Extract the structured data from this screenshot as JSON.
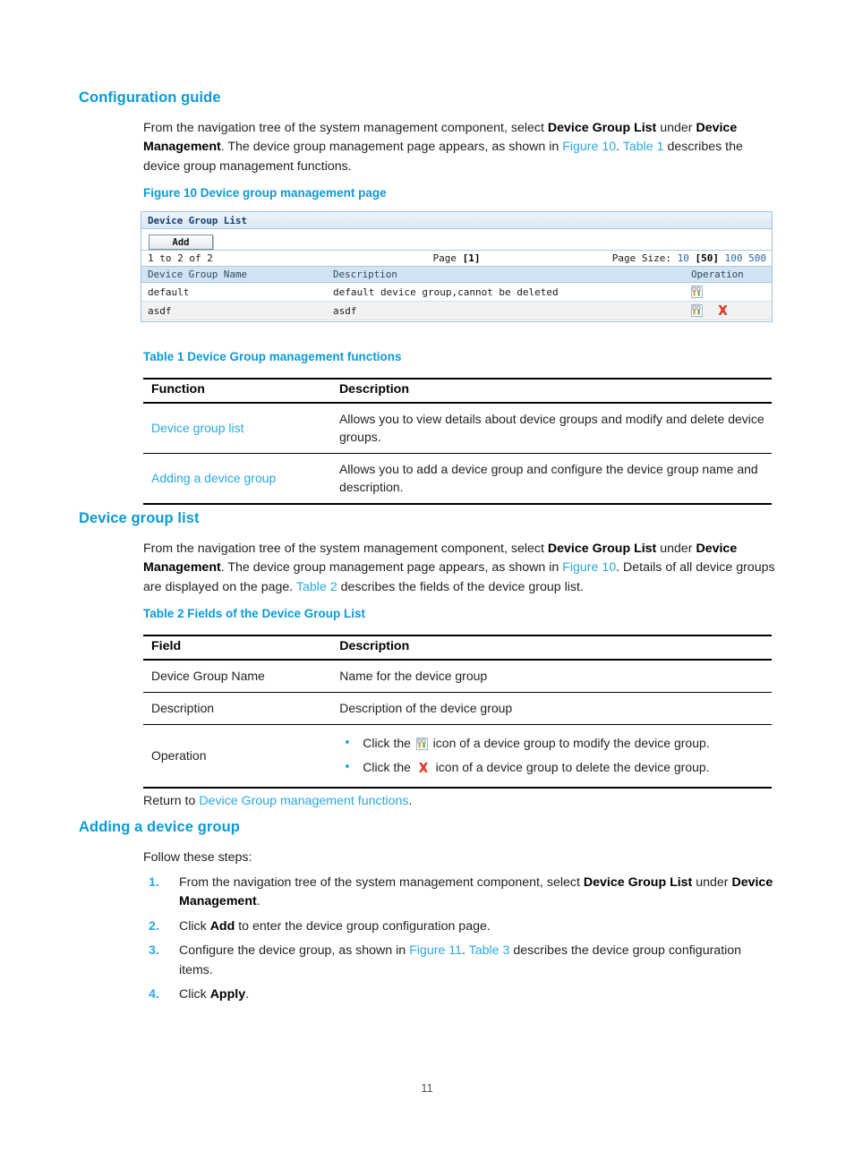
{
  "sections": {
    "configuration_guide": {
      "heading": "Configuration guide",
      "para_parts": [
        {
          "t": "From the navigation tree of the system management component, select ",
          "s": "n"
        },
        {
          "t": "Device Group List",
          "s": "b"
        },
        {
          "t": " under ",
          "s": "n"
        },
        {
          "t": "Device Management",
          "s": "b"
        },
        {
          "t": ". The device group management page appears, as shown in ",
          "s": "n"
        },
        {
          "t": "Figure 10",
          "s": "l"
        },
        {
          "t": ". ",
          "s": "n"
        },
        {
          "t": "Table 1",
          "s": "l"
        },
        {
          "t": " describes the device group management functions.",
          "s": "n"
        }
      ]
    },
    "device_group_list": {
      "heading": "Device group list",
      "para_parts": [
        {
          "t": "From the navigation tree of the system management component, select ",
          "s": "n"
        },
        {
          "t": "Device Group List",
          "s": "b"
        },
        {
          "t": " under ",
          "s": "n"
        },
        {
          "t": "Device Management",
          "s": "b"
        },
        {
          "t": ". The device group management page appears, as shown in ",
          "s": "n"
        },
        {
          "t": "Figure 10",
          "s": "l"
        },
        {
          "t": ". Details of all device groups are displayed on the page. ",
          "s": "n"
        },
        {
          "t": "Table 2",
          "s": "l"
        },
        {
          "t": " describes the fields of the device group list.",
          "s": "n"
        }
      ],
      "return_prefix": "Return to ",
      "return_link": "Device Group management functions",
      "return_suffix": "."
    },
    "adding_a_device_group": {
      "heading": "Adding a device group",
      "intro": "Follow these steps:",
      "steps": [
        {
          "num": "1.",
          "parts": [
            {
              "t": "From the navigation tree of the system management component, select ",
              "s": "n"
            },
            {
              "t": "Device Group List",
              "s": "b"
            },
            {
              "t": " under ",
              "s": "n"
            },
            {
              "t": "Device Management",
              "s": "b"
            },
            {
              "t": ".",
              "s": "n"
            }
          ]
        },
        {
          "num": "2.",
          "parts": [
            {
              "t": "Click ",
              "s": "n"
            },
            {
              "t": "Add",
              "s": "b"
            },
            {
              "t": " to enter the device group configuration page.",
              "s": "n"
            }
          ]
        },
        {
          "num": "3.",
          "parts": [
            {
              "t": "Configure the device group, as shown in ",
              "s": "n"
            },
            {
              "t": "Figure 11",
              "s": "l"
            },
            {
              "t": ". ",
              "s": "n"
            },
            {
              "t": "Table 3",
              "s": "l"
            },
            {
              "t": " describes the device group configuration items.",
              "s": "n"
            }
          ]
        },
        {
          "num": "4.",
          "parts": [
            {
              "t": "Click ",
              "s": "n"
            },
            {
              "t": "Apply",
              "s": "b"
            },
            {
              "t": ".",
              "s": "n"
            }
          ]
        }
      ]
    }
  },
  "figure10": {
    "caption": "Figure 10 Device group management page",
    "panel_title": "Device Group List",
    "add_button_label": "Add",
    "pager": {
      "range_text": "1 to 2 of 2",
      "page_label": "Page",
      "page_current": "[1]",
      "page_size_label": "Page Size:",
      "page_size_options": [
        "10",
        "50",
        "100",
        "500"
      ],
      "page_size_selected": "50"
    },
    "columns": [
      "Device Group Name",
      "Description",
      "Operation"
    ],
    "rows": [
      {
        "name": "default",
        "description": "default device group,cannot be deleted",
        "icons": [
          "modify-icon"
        ]
      },
      {
        "name": "asdf",
        "description": "asdf",
        "icons": [
          "modify-icon",
          "delete-icon"
        ]
      }
    ]
  },
  "table1": {
    "caption": "Table 1 Device Group management functions",
    "headers": [
      "Function",
      "Description"
    ],
    "rows": [
      {
        "function": "Device group list",
        "description": "Allows you to view details about device groups and modify and delete device groups."
      },
      {
        "function": "Adding a device group",
        "description": "Allows you to add a device group and configure the device group name and description."
      }
    ]
  },
  "table2": {
    "caption": "Table 2 Fields of the Device Group List",
    "headers": [
      "Field",
      "Description"
    ],
    "rows": [
      {
        "field": "Device Group Name",
        "description": "Name for the device group"
      },
      {
        "field": "Description",
        "description": "Description of the device group"
      }
    ],
    "operation_row": {
      "field": "Operation",
      "bullets": [
        {
          "prefix": "Click the ",
          "icon": "modify-icon",
          "suffix": " icon of a device group to modify the device group."
        },
        {
          "prefix": "Click the ",
          "icon": "delete-icon",
          "suffix": " icon of a device group to delete the device group."
        }
      ]
    }
  },
  "footer": {
    "page_number": "11"
  },
  "colors": {
    "heading_blue": "#0b9ad6",
    "link_blue": "#2aa8e0",
    "ui_header_text": "#17406b",
    "ui_grid_header_bg": "#d2e4f4",
    "ui_border": "#9dc3d8",
    "delete_icon_red": "#e8402a",
    "modify_icon_orange": "#f0921e",
    "modify_icon_green": "#4cae2a"
  }
}
